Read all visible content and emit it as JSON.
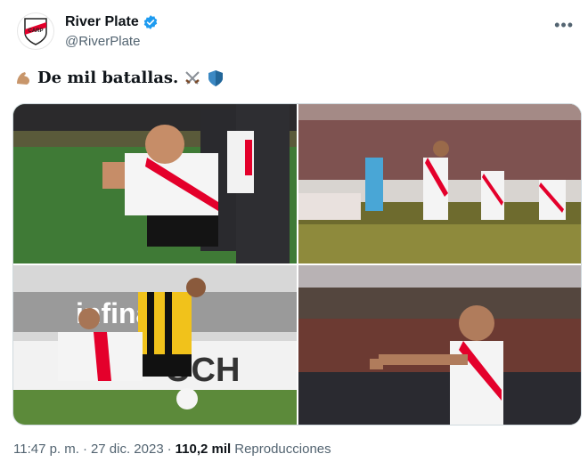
{
  "author": {
    "display_name": "River Plate",
    "handle": "@RiverPlate",
    "verified": true
  },
  "tweet": {
    "text": "De mil batallas.",
    "emojis": [
      "flexed-biceps",
      "crossed-swords",
      "shield"
    ]
  },
  "images": [
    {
      "name": "photo-player-thumbs-up"
    },
    {
      "name": "photo-players-celebrating-stadium"
    },
    {
      "name": "photo-player-sliding-tackle"
    },
    {
      "name": "photo-player-pointing"
    }
  ],
  "meta": {
    "time": "11:47 p. m.",
    "separator": "·",
    "date": "27 dic. 2023",
    "views": "110,2 mil",
    "views_label": "Reproducciones"
  },
  "colors": {
    "verified_blue": "#1d9bf0",
    "river_red": "#e4002b",
    "text_primary": "#0f1419",
    "text_secondary": "#536471"
  }
}
